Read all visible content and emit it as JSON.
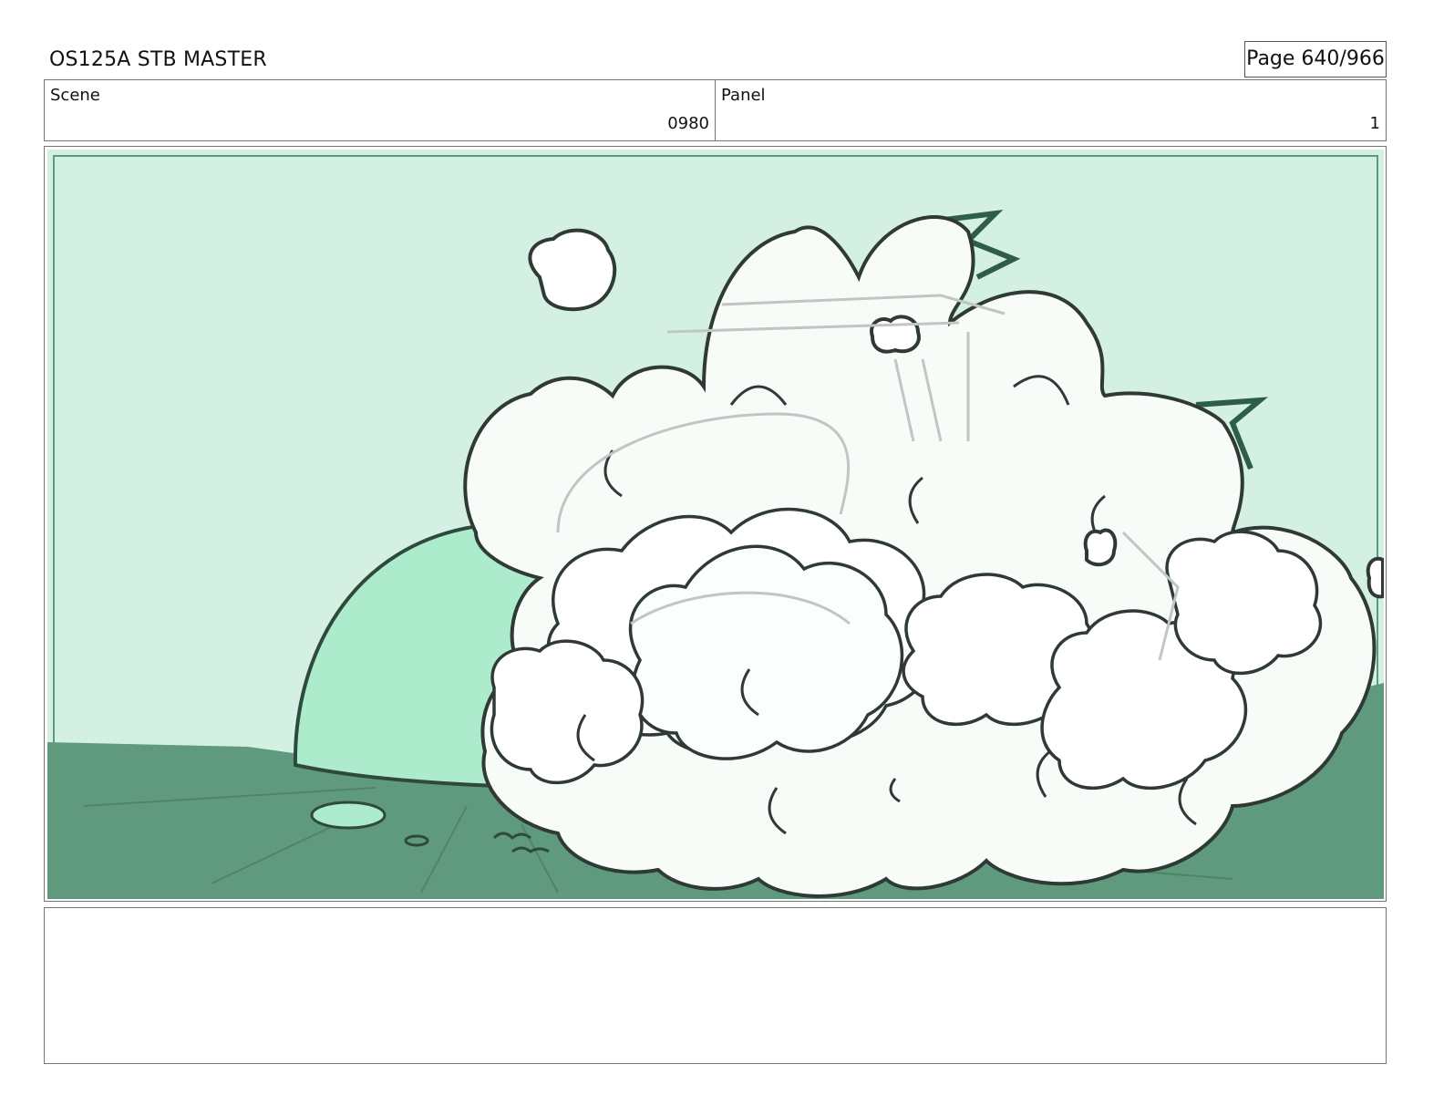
{
  "header": {
    "title": "OS125A STB MASTER",
    "page": "Page 640/966"
  },
  "info": {
    "scene_label": "Scene",
    "scene_value": "0980",
    "panel_label": "Panel",
    "panel_value": "1"
  },
  "panel": {
    "sky_color": "#d3f0e3",
    "ground_color": "#5f9a7e",
    "dome_color": "#acebcb",
    "cloud_color": "#f7fcf9",
    "line_color": "#2f4a3d"
  },
  "notes": {
    "text": ""
  }
}
